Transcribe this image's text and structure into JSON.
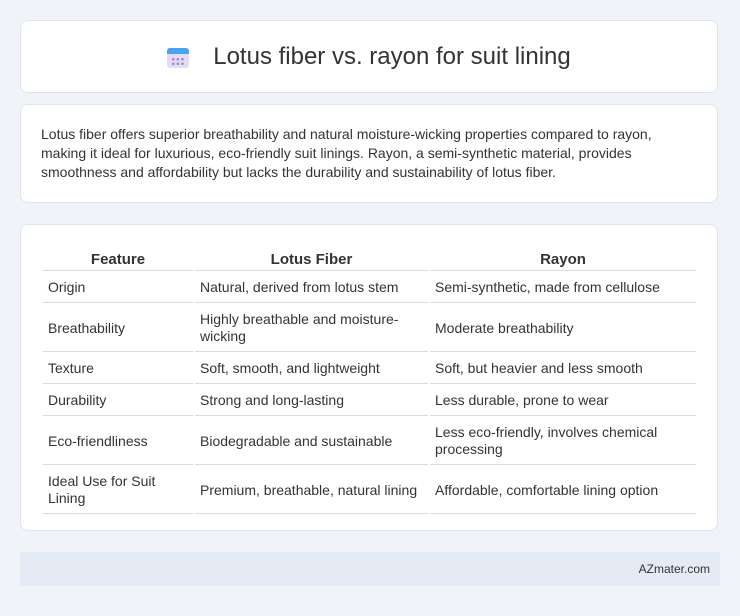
{
  "header": {
    "title": "Lotus fiber vs. rayon for suit lining",
    "icon": "calendar-icon"
  },
  "summary": {
    "text": "Lotus fiber offers superior breathability and natural moisture-wicking properties compared to rayon, making it ideal for luxurious, eco-friendly suit linings. Rayon, a semi-synthetic material, provides smoothness and affordability but lacks the durability and sustainability of lotus fiber."
  },
  "table": {
    "headers": [
      "Feature",
      "Lotus Fiber",
      "Rayon"
    ],
    "rows": [
      [
        "Origin",
        "Natural, derived from lotus stem",
        "Semi-synthetic, made from cellulose"
      ],
      [
        "Breathability",
        "Highly breathable and moisture-wicking",
        "Moderate breathability"
      ],
      [
        "Texture",
        "Soft, smooth, and lightweight",
        "Soft, but heavier and less smooth"
      ],
      [
        "Durability",
        "Strong and long-lasting",
        "Less durable, prone to wear"
      ],
      [
        "Eco-friendliness",
        "Biodegradable and sustainable",
        "Less eco-friendly, involves chemical processing"
      ],
      [
        "Ideal Use for Suit Lining",
        "Premium, breathable, natural lining",
        "Affordable, comfortable lining option"
      ]
    ]
  },
  "footer": {
    "site": "AZmater.com"
  }
}
